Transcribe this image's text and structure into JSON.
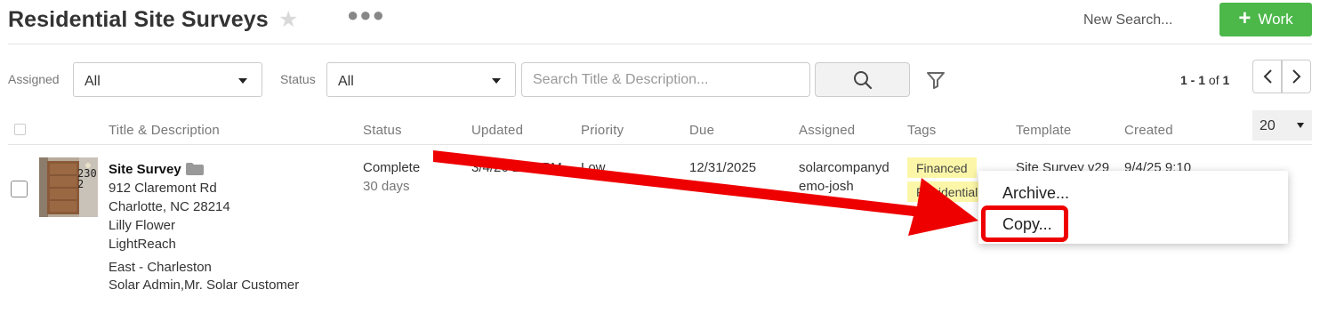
{
  "header": {
    "title": "Residential Site Surveys",
    "star_icon": "star-icon",
    "more_icon": "more-dots-icon",
    "new_search": "New Search...",
    "work_button": "Work",
    "work_button_icon": "plus-icon"
  },
  "filters": {
    "assigned_label": "Assigned",
    "assigned_value": "All",
    "status_label": "Status",
    "status_value": "All",
    "search_placeholder": "Search Title & Description...",
    "search_icon": "search-icon",
    "filter_icon": "funnel-icon"
  },
  "pagination": {
    "range": "1 - 1",
    "of_text": "of",
    "total": "1",
    "prev_icon": "chevron-left-icon",
    "next_icon": "chevron-right-icon",
    "page_size": "20"
  },
  "table": {
    "columns": [
      "Title & Description",
      "Status",
      "Updated",
      "Priority",
      "Due",
      "Assigned",
      "Tags",
      "Template",
      "Created"
    ],
    "rows": [
      {
        "thumbnail": "house-door-photo",
        "thumbnail_number": "2302",
        "title": "Site Survey",
        "title_icon": "folder-icon",
        "address_1": "912 Claremont Rd",
        "address_2": "Charlotte, NC 28214",
        "contact": "Lilly Flower",
        "company": "LightReach",
        "region": "East - Charleston",
        "roles": "Solar Admin,Mr. Solar Customer",
        "status": "Complete",
        "status_age": "30 days",
        "updated": "3/4/26 2:24 PM",
        "priority": "Low",
        "due": "12/31/2025",
        "assigned_1": "solarcompanyd",
        "assigned_2": "emo-josh",
        "tags": [
          "Financed",
          "Residential"
        ],
        "template": "Site Survey v29",
        "created": "9/4/25 9:10"
      }
    ]
  },
  "context_menu": {
    "items": [
      "Archive...",
      "Copy..."
    ],
    "highlighted_item": "Copy..."
  },
  "colors": {
    "accent_green": "#4cb84a",
    "tag_yellow": "#fcf7a8",
    "annotation_red": "#ee0000"
  }
}
